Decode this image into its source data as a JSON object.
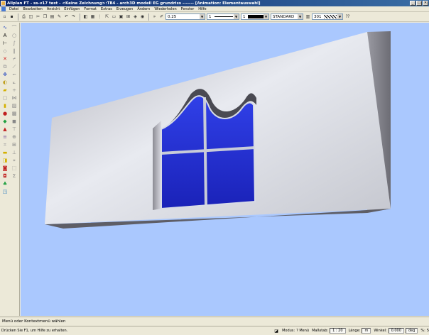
{
  "window": {
    "title": "Allplan FT - ss-v17 test - <Keine Zeichnung>:TB4 - arch3D modell EG grundriss ------- [Animation: Elementauswahl]",
    "minimize": "_",
    "maximize": "□",
    "close": "✕"
  },
  "menu": {
    "items": [
      "Datei",
      "Bearbeiten",
      "Ansicht",
      "Einfügen",
      "Format",
      "Extras",
      "Erzeugen",
      "Ändern",
      "Wiederholen",
      "Fenster",
      "Hilfe"
    ]
  },
  "toolbar": {
    "pen_value": "0.25",
    "line_value": "1",
    "color_value": "1",
    "style_value": "STANDARD",
    "hatch_value": "301"
  },
  "message_bar": {
    "text": "Menü oder Kontextmenü wählen"
  },
  "status": {
    "hint": "Drücken Sie F1, um Hilfe zu erhalten.",
    "mode_label": "Modus:",
    "mode_value": "? Menü",
    "scale_label": "Maßstab:",
    "scale_value": "1 : 20",
    "length_label": "Länge:",
    "length_value": "m",
    "angle_label": "Winkel:",
    "angle_value": "0.000",
    "angle_unit": "deg",
    "percent_label": "%:",
    "percent_value": "5"
  },
  "colors": {
    "viewport_bg": "#aac8fe",
    "glass": "#1f2fd8",
    "wall_light": "#dcdfe8",
    "wall_dark": "#5a5a5a"
  }
}
